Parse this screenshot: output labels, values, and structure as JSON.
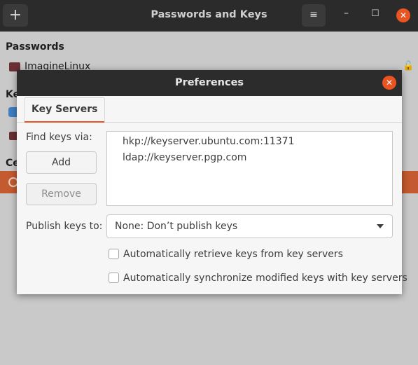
{
  "window": {
    "title": "Passwords and Keys",
    "add_glyph": "+",
    "menu_glyph": "≡",
    "minimize_glyph": "–",
    "maximize_glyph": "☐",
    "close_glyph": "✕"
  },
  "background": {
    "passwords_heading": "Passwords",
    "keyring_label": "ImagineLinux",
    "keys_heading_partial": "Ke",
    "certificates_heading_partial": "Ce"
  },
  "dialog": {
    "title": "Preferences",
    "close_glyph": "✕",
    "tabs": [
      {
        "label": "Key Servers",
        "active": true
      }
    ],
    "find_keys_label": "Find keys via:",
    "add_button": "Add",
    "remove_button": "Remove",
    "servers": [
      "hkp://keyserver.ubuntu.com:11371",
      "ldap://keyserver.pgp.com"
    ],
    "publish_label": "Publish keys to:",
    "publish_selected": "None: Don’t publish keys",
    "checkboxes": [
      {
        "label": "Automatically retrieve keys from key servers",
        "checked": false
      },
      {
        "label": "Automatically synchronize modified keys with key servers",
        "checked": false
      }
    ]
  },
  "colors": {
    "accent": "#e95420",
    "titlebar": "#2b2b2b",
    "selection": "#c45a2f"
  }
}
